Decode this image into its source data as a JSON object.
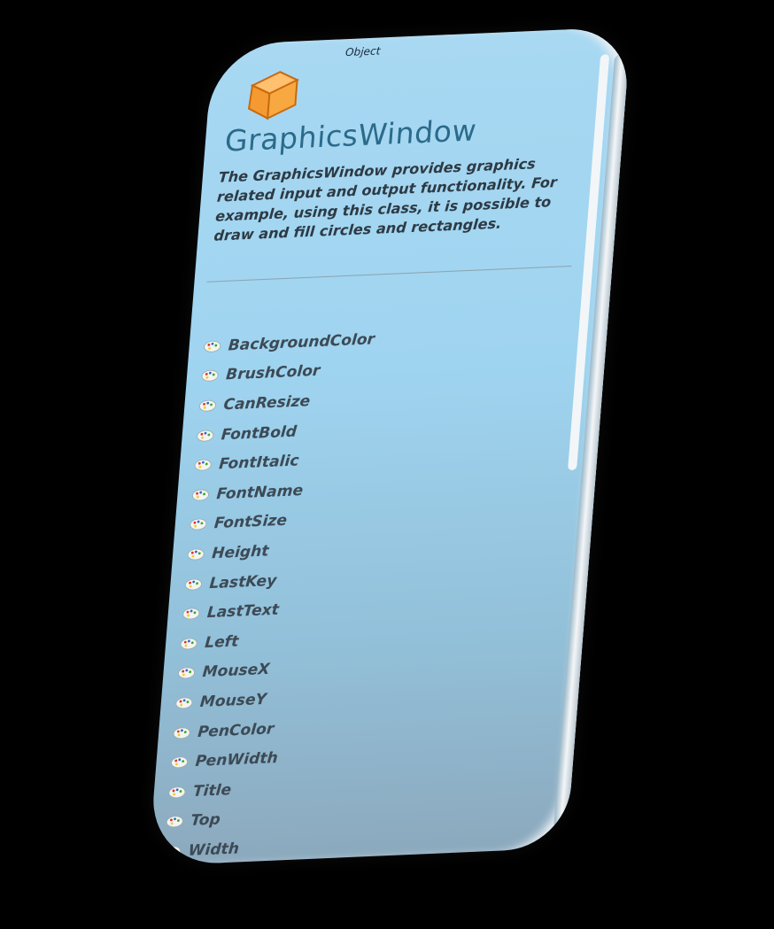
{
  "breadcrumb": "Object",
  "title": "GraphicsWindow",
  "description": "The GraphicsWindow provides graphics related input and output functionality. For example, using this class, it is possible to draw and fill circles and rectangles.",
  "property_icon": "palette-icon",
  "class_icon": "orange-cube-icon",
  "properties": [
    "BackgroundColor",
    "BrushColor",
    "CanResize",
    "FontBold",
    "FontItalic",
    "FontName",
    "FontSize",
    "Height",
    "LastKey",
    "LastText",
    "Left",
    "MouseX",
    "MouseY",
    "PenColor",
    "PenWidth",
    "Title",
    "Top",
    "Width"
  ],
  "colors": {
    "title": "#2b6a8a",
    "panel": "#a8d8f2",
    "cube": "#f59a30"
  }
}
